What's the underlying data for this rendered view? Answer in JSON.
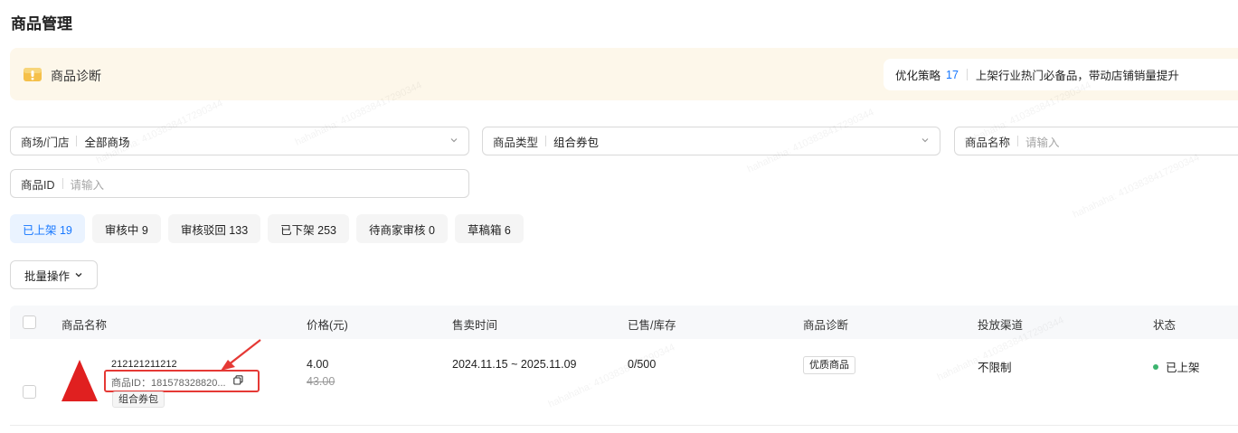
{
  "page": {
    "title": "商品管理"
  },
  "diagnosis": {
    "title": "商品诊断",
    "strategy_label": "优化策略",
    "strategy_count": "17",
    "strategy_text": "上架行业热门必备品，带动店铺销量提升"
  },
  "filters": {
    "mall": {
      "label": "商场/门店",
      "value": "全部商场"
    },
    "type": {
      "label": "商品类型",
      "value": "组合券包"
    },
    "name": {
      "label": "商品名称",
      "placeholder": "请输入"
    },
    "id": {
      "label": "商品ID",
      "placeholder": "请输入"
    }
  },
  "tabs": [
    {
      "label": "已上架 19",
      "active": true
    },
    {
      "label": "审核中 9"
    },
    {
      "label": "审核驳回 133"
    },
    {
      "label": "已下架 253"
    },
    {
      "label": "待商家审核 0"
    },
    {
      "label": "草稿箱 6"
    }
  ],
  "batch_label": "批量操作",
  "table": {
    "columns": [
      "商品名称",
      "价格(元)",
      "售卖时间",
      "已售/库存",
      "商品诊断",
      "投放渠道",
      "状态"
    ],
    "rows": [
      {
        "name": "212121211212",
        "id": "商品ID：181578328820...",
        "tag": "组合券包",
        "price": "4.00",
        "original_price": "43.00",
        "time": "2024.11.15 ~ 2025.11.09",
        "stock": "0/500",
        "diagnosis": "优质商品",
        "channel": "不限制",
        "status": "已上架"
      }
    ]
  },
  "watermark": "hahahaha: 4103838417290344",
  "colors": {
    "accent": "#1677ff",
    "annotation": "#e53935",
    "status_ok": "#3cb46e",
    "banner_bg": "#fdf7ea"
  }
}
